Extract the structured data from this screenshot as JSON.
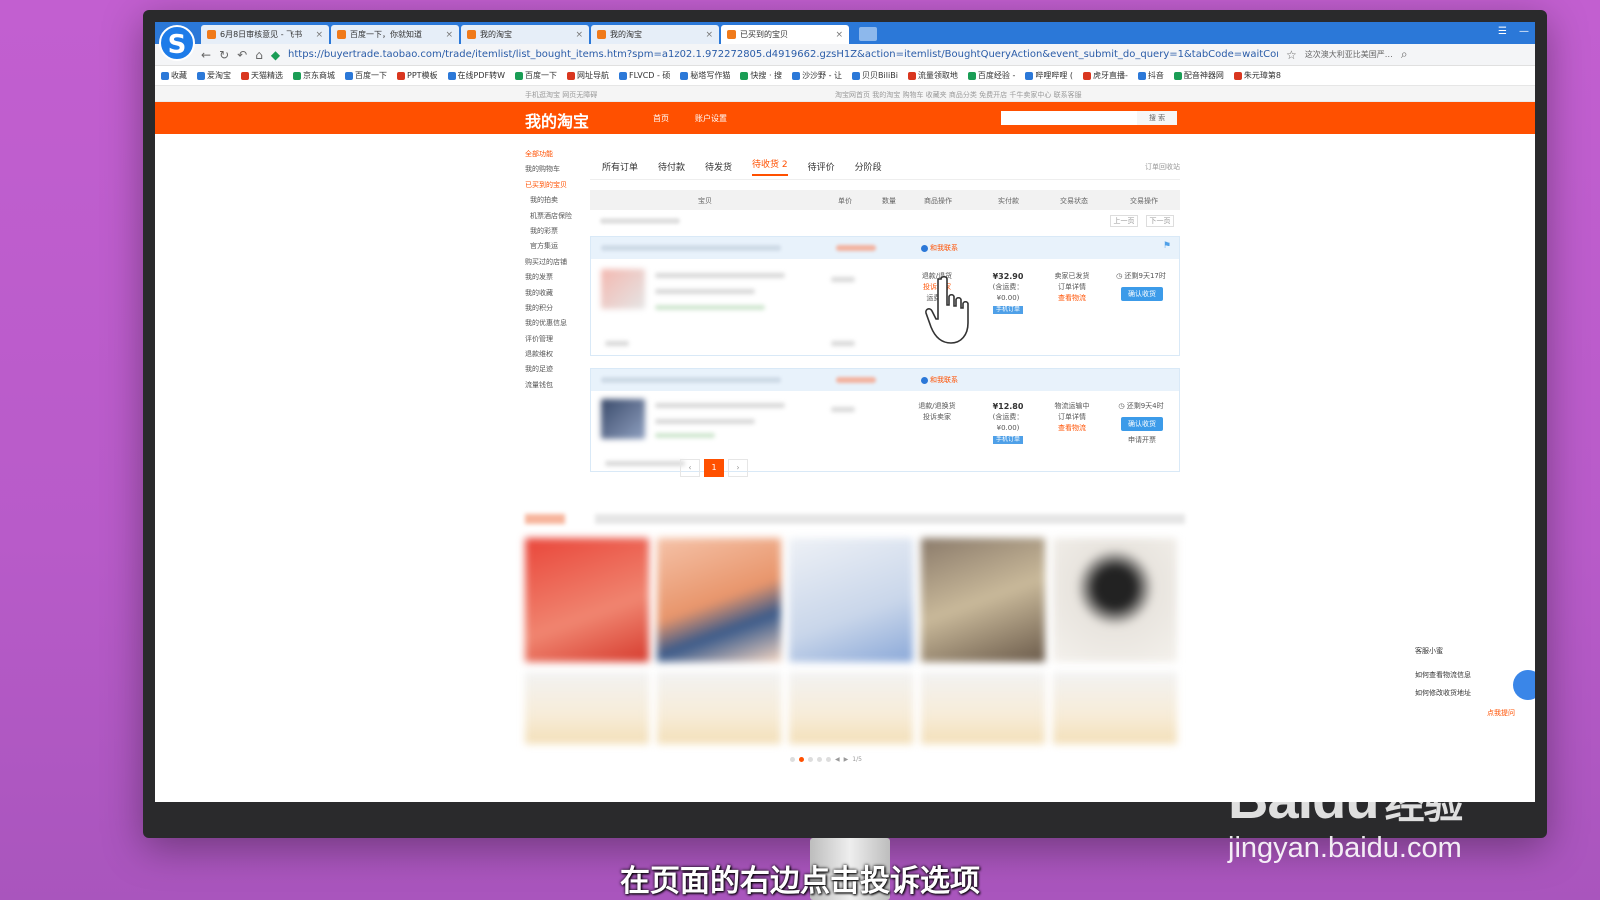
{
  "browser": {
    "tabs": [
      {
        "label": "6月8日审核意见 - 飞书"
      },
      {
        "label": "百度一下，你就知道"
      },
      {
        "label": "我的淘宝"
      },
      {
        "label": "我的淘宝"
      },
      {
        "label": "已买到的宝贝",
        "active": true
      }
    ],
    "url": "https://buyertrade.taobao.com/trade/itemlist/list_bought_items.htm?spm=a1z02.1.972272805.d4919662.gzsH1Z&action=itemlist/BoughtQueryAction&event_submit_do_query=1&tabCode=waitConfirm",
    "address_right": "这次澳大利亚比美国严…",
    "bookmarks": [
      "收藏",
      "爱淘宝",
      "天猫精选",
      "京东商城",
      "百度一下",
      "PPT模板",
      "在线PDF转W",
      "百度一下",
      "网址导航",
      "FLVCD - 硕",
      "秘塔写作猫",
      "快搜 · 搜",
      "沙沙野 - 让",
      "贝贝BiliBi",
      "流量领取地",
      "百度经验 -",
      "哔哩哔哩 (",
      "虎牙直播-",
      "抖音",
      "配音神器网",
      "朱元璋第8"
    ]
  },
  "site": {
    "topnav_left": "手机逛淘宝    网页无障碍",
    "topnav_right": "淘宝网首页   我的淘宝   购物车   收藏夹   商品分类   免费开店   千牛卖家中心   联系客服",
    "logo": "我的淘宝",
    "nav_home": "首页",
    "nav_account": "账户设置",
    "search_btn": "搜 索"
  },
  "sidebar": {
    "items": [
      {
        "label": "全部功能",
        "hl": true
      },
      {
        "label": "我的购物车"
      },
      {
        "label": "已买到的宝贝",
        "hl": true
      },
      {
        "label": "我的拍卖",
        "sub": true
      },
      {
        "label": "机票酒店保险",
        "sub": true
      },
      {
        "label": "我的彩票",
        "sub": true
      },
      {
        "label": "官方集运",
        "sub": true
      },
      {
        "label": "购买过的店铺"
      },
      {
        "label": "我的发票"
      },
      {
        "label": "我的收藏"
      },
      {
        "label": "我的积分"
      },
      {
        "label": "我的优惠信息"
      },
      {
        "label": "评价管理"
      },
      {
        "label": "退款维权"
      },
      {
        "label": "我的足迹"
      },
      {
        "label": "流量钱包"
      }
    ]
  },
  "orders_tabs": [
    "所有订单",
    "待付款",
    "待发货",
    "待收货 2",
    "待评价",
    "分阶段"
  ],
  "recycle": "订单回收站",
  "table_headers": [
    "宝贝",
    "单价",
    "数量",
    "商品操作",
    "实付款",
    "交易状态",
    "交易操作"
  ],
  "pager_prev": "上一页",
  "pager_next": "下一页",
  "orders": [
    {
      "contact": "和我联系",
      "ops": [
        "退款/退货",
        "投诉卖家",
        "运费险"
      ],
      "price": "¥32.90",
      "shipping": "(含运费：¥0.00)",
      "tag": "手机订单",
      "status": [
        "卖家已发货",
        "订单详情",
        "查看物流"
      ],
      "remaining": "还剩9天17时",
      "confirm": "确认收货",
      "extra": ""
    },
    {
      "contact": "和我联系",
      "ops": [
        "退款/退换货",
        "投诉卖家"
      ],
      "price": "¥12.80",
      "shipping": "(含运费：¥0.00)",
      "tag": "手机订单",
      "status": [
        "物流运输中",
        "订单详情",
        "查看物流"
      ],
      "remaining": "还剩9天4时",
      "confirm": "确认收货",
      "extra": "申请开票"
    }
  ],
  "page_current": "1",
  "recs_counter": "1/5",
  "customer_service": {
    "title": "客服小蜜",
    "q1": "如何查看物流信息",
    "q2": "如何修改收货地址",
    "more": "点我提问"
  },
  "caption": "在页面的右边点击投诉选项",
  "watermark": {
    "logo": "Bai",
    "logo2": "du",
    "jingyan": "经验",
    "url": "jingyan.baidu.com"
  },
  "colors": {
    "taobao_orange": "#ff5000",
    "tab_blue": "#2b78d8",
    "confirm_blue": "#3c9be9",
    "bg_purple": "#c25fd0"
  }
}
